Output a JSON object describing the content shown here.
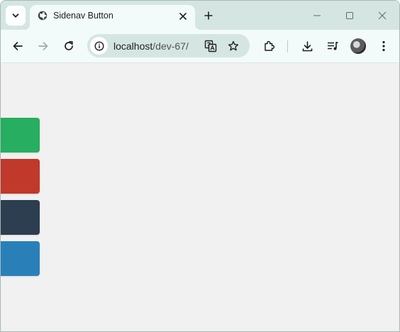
{
  "browser": {
    "tab": {
      "title": "Sidenav Button",
      "favicon": "globe-icon"
    },
    "address_bar": {
      "host": "localhost",
      "path": "/dev-67/"
    },
    "icons": {
      "tab_search": "chevron-down-icon",
      "new_tab": "plus-icon",
      "minimize": "minimize-icon",
      "maximize": "maximize-icon",
      "close": "close-icon",
      "back": "back-arrow-icon",
      "forward": "forward-arrow-icon",
      "reload": "reload-icon",
      "site_info": "info-icon",
      "translate": "translate-icon",
      "bookmark": "star-icon",
      "extensions": "puzzle-icon",
      "downloads": "download-icon",
      "media": "media-queue-icon",
      "profile": "avatar",
      "menu": "kebab-menu-icon"
    }
  },
  "page": {
    "sidenav_buttons": [
      {
        "name": "green",
        "color": "#27ae60"
      },
      {
        "name": "red",
        "color": "#c0392b"
      },
      {
        "name": "navy",
        "color": "#2c3e50"
      },
      {
        "name": "blue",
        "color": "#2980b9"
      }
    ]
  }
}
